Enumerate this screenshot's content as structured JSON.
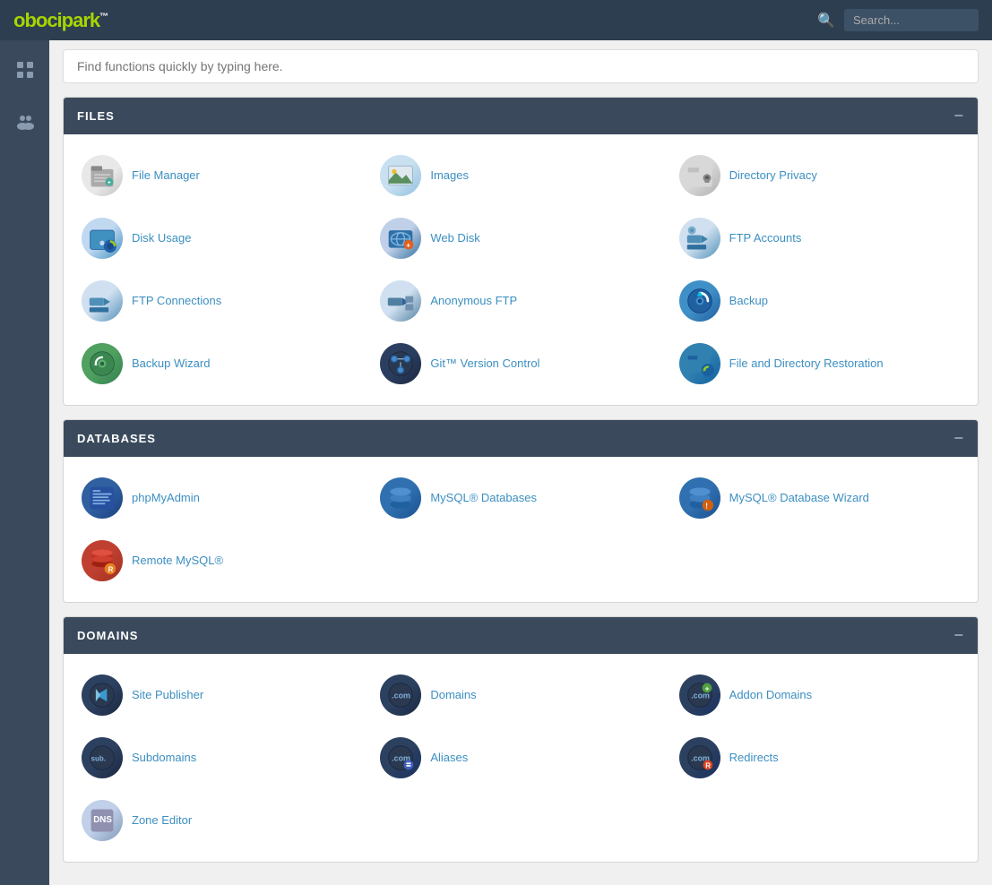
{
  "topNav": {
    "logo": "obocipark",
    "logoTM": "™",
    "searchPlaceholder": "Search..."
  },
  "mainSearch": {
    "placeholder": "Find functions quickly by typing here."
  },
  "sections": [
    {
      "id": "files",
      "label": "FILES",
      "items": [
        {
          "id": "file-manager",
          "label": "File Manager",
          "iconClass": "ic-file-manager"
        },
        {
          "id": "images",
          "label": "Images",
          "iconClass": "ic-images"
        },
        {
          "id": "directory-privacy",
          "label": "Directory Privacy",
          "iconClass": "ic-directory-privacy"
        },
        {
          "id": "disk-usage",
          "label": "Disk Usage",
          "iconClass": "ic-disk-usage"
        },
        {
          "id": "web-disk",
          "label": "Web Disk",
          "iconClass": "ic-web-disk"
        },
        {
          "id": "ftp-accounts",
          "label": "FTP Accounts",
          "iconClass": "ic-ftp-accounts"
        },
        {
          "id": "ftp-connections",
          "label": "FTP Connections",
          "iconClass": "ic-ftp-connections"
        },
        {
          "id": "anonymous-ftp",
          "label": "Anonymous FTP",
          "iconClass": "ic-anon-ftp"
        },
        {
          "id": "backup",
          "label": "Backup",
          "iconClass": "ic-backup"
        },
        {
          "id": "backup-wizard",
          "label": "Backup Wizard",
          "iconClass": "ic-backup-wizard"
        },
        {
          "id": "git-version-control",
          "label": "Git™ Version Control",
          "iconClass": "ic-git"
        },
        {
          "id": "file-directory-restoration",
          "label": "File and Directory Restoration",
          "iconClass": "ic-file-restore"
        }
      ]
    },
    {
      "id": "databases",
      "label": "DATABASES",
      "items": [
        {
          "id": "phpmyadmin",
          "label": "phpMyAdmin",
          "iconClass": "ic-phpmyadmin"
        },
        {
          "id": "mysql-databases",
          "label": "MySQL® Databases",
          "iconClass": "ic-mysql"
        },
        {
          "id": "mysql-database-wizard",
          "label": "MySQL® Database Wizard",
          "iconClass": "ic-mysql-wizard"
        },
        {
          "id": "remote-mysql",
          "label": "Remote MySQL®",
          "iconClass": "ic-remote-mysql"
        }
      ]
    },
    {
      "id": "domains",
      "label": "DOMAINS",
      "items": [
        {
          "id": "site-publisher",
          "label": "Site Publisher",
          "iconClass": "ic-site-publisher"
        },
        {
          "id": "domains",
          "label": "Domains",
          "iconClass": "ic-domains"
        },
        {
          "id": "addon-domains",
          "label": "Addon Domains",
          "iconClass": "ic-addon-domains"
        },
        {
          "id": "subdomains",
          "label": "Subdomains",
          "iconClass": "ic-subdomains"
        },
        {
          "id": "aliases",
          "label": "Aliases",
          "iconClass": "ic-aliases"
        },
        {
          "id": "redirects",
          "label": "Redirects",
          "iconClass": "ic-redirects"
        },
        {
          "id": "zone-editor",
          "label": "Zone Editor",
          "iconClass": "ic-zone-editor"
        }
      ]
    }
  ],
  "sidebar": {
    "icons": [
      "grid",
      "users"
    ]
  }
}
